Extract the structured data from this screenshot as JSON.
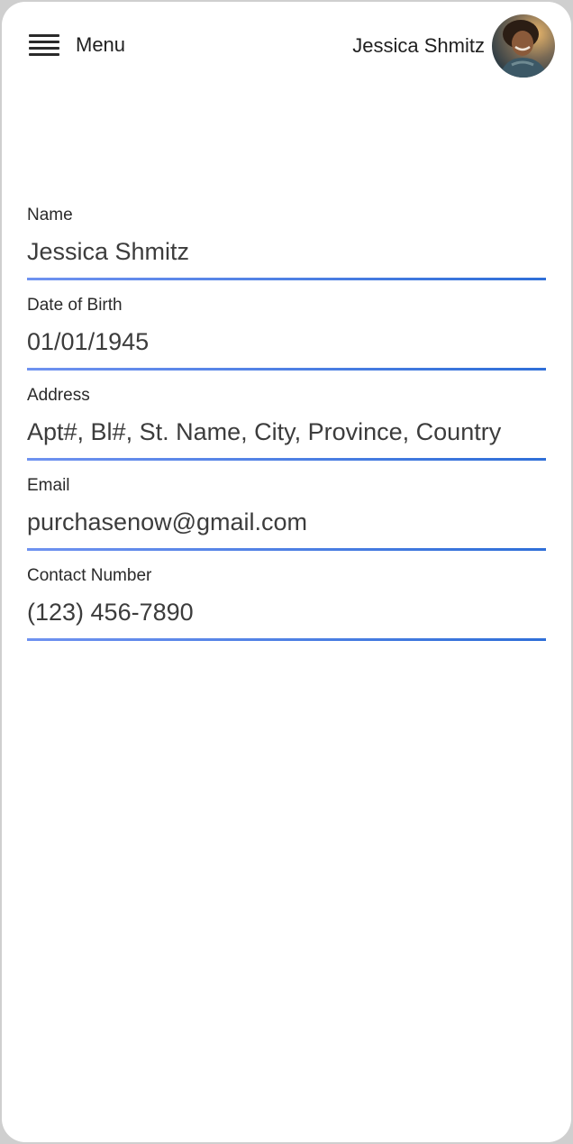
{
  "header": {
    "menu_label": "Menu",
    "menu_icon": "hamburger-icon",
    "user_name": "Jessica Shmitz",
    "avatar_icon": "user-avatar"
  },
  "colors": {
    "underline_start": "#6f92f0",
    "underline_end": "#2f6fd8",
    "text": "#3c3c3c"
  },
  "form": {
    "fields": [
      {
        "label": "Name",
        "value": "Jessica Shmitz"
      },
      {
        "label": "Date of Birth",
        "value": "01/01/1945"
      },
      {
        "label": "Address",
        "value": "Apt#, Bl#, St. Name, City, Province, Country"
      },
      {
        "label": "Email",
        "value": "purchasenow@gmail.com"
      },
      {
        "label": "Contact Number",
        "value": "(123) 456-7890"
      }
    ]
  }
}
